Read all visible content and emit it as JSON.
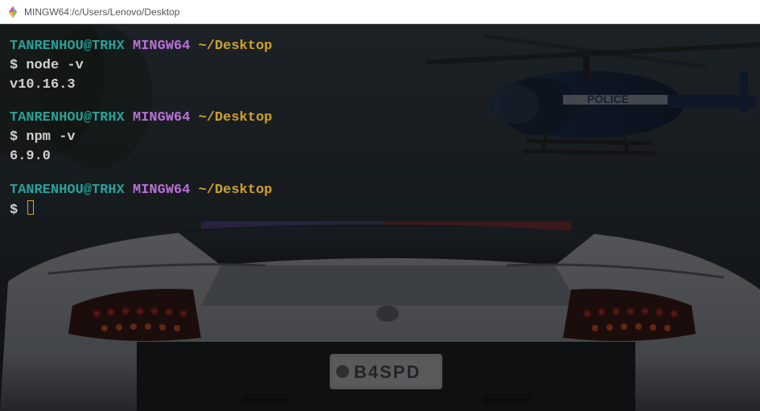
{
  "titlebar": {
    "title": "MINGW64:/c/Users/Lenovo/Desktop"
  },
  "prompt": {
    "user": "TANRENHOU@TRHX",
    "env": "MINGW64",
    "path": "~/Desktop",
    "symbol": "$"
  },
  "blocks": [
    {
      "command": "node -v",
      "output": "v10.16.3"
    },
    {
      "command": "npm -v",
      "output": "6.9.0"
    }
  ],
  "icons": {
    "app": "mingw-diamond-icon"
  }
}
